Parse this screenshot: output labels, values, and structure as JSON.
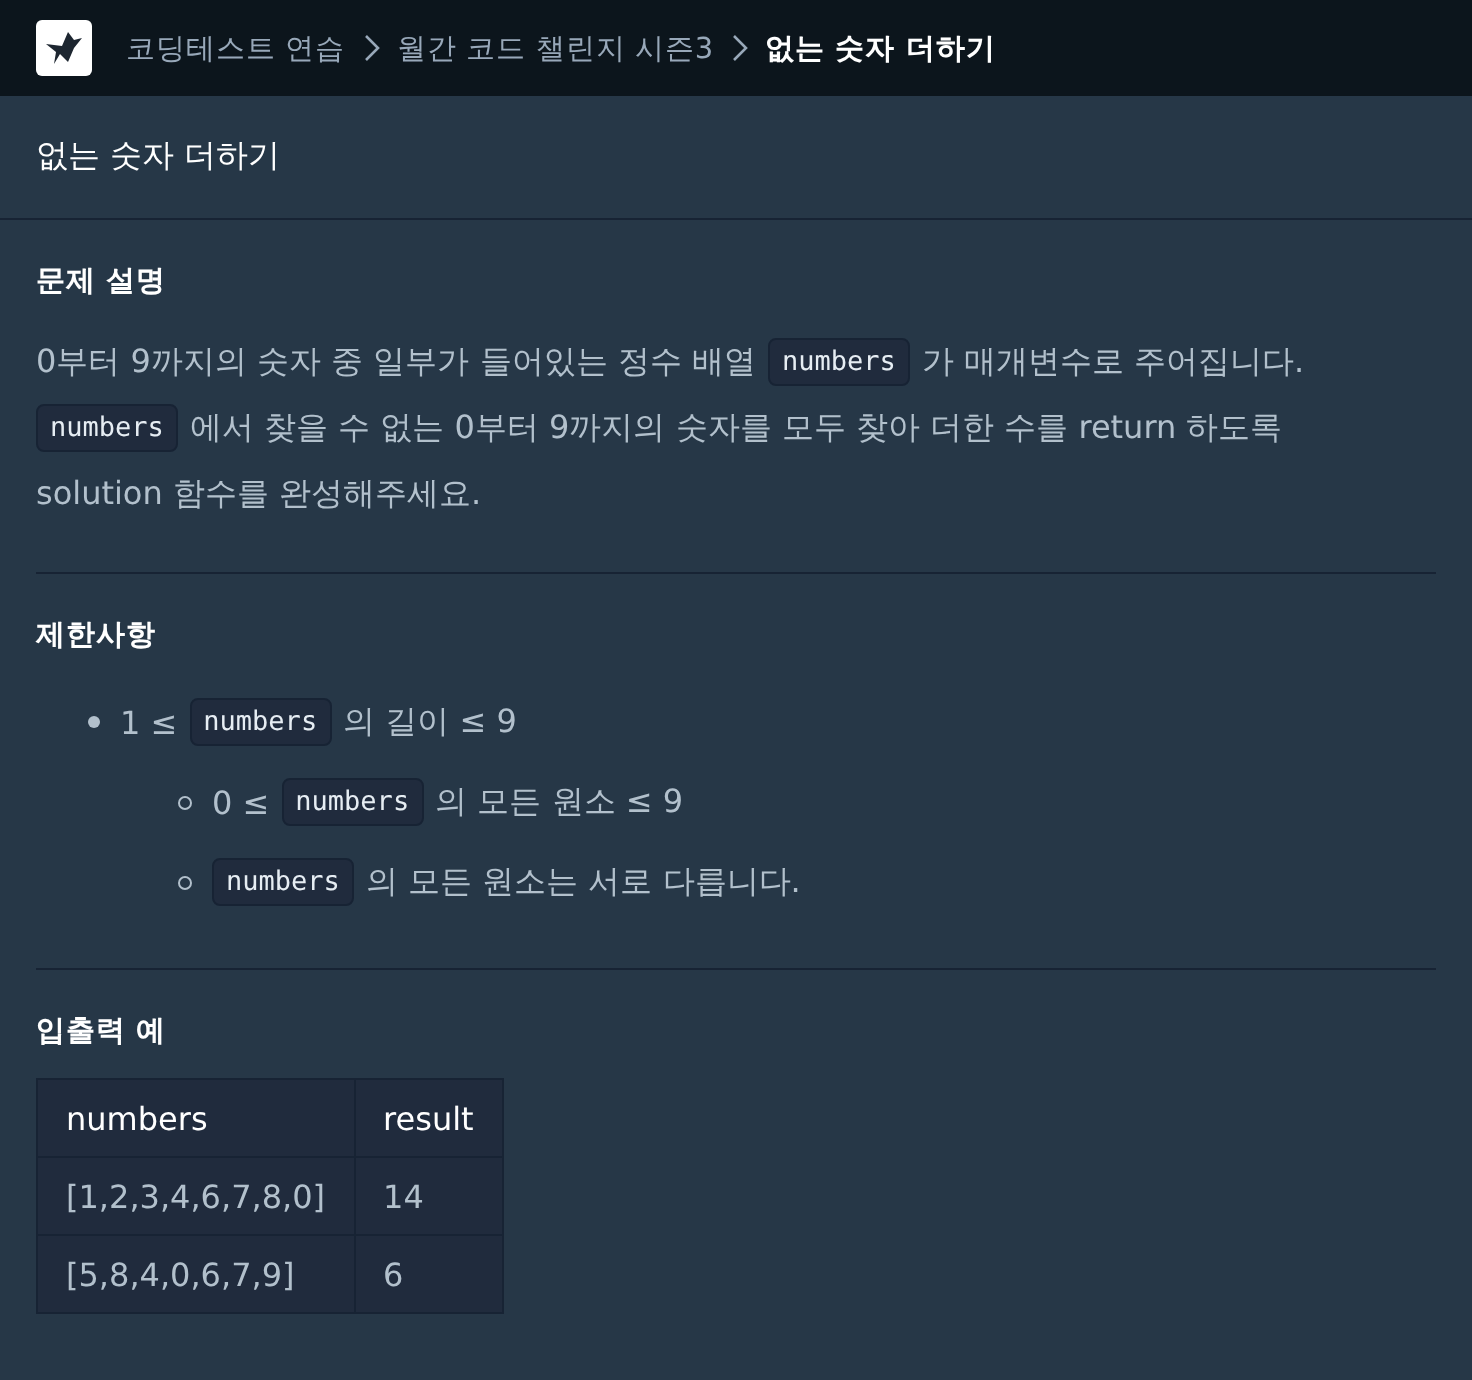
{
  "breadcrumb": [
    {
      "label": "코딩테스트 연습",
      "current": false
    },
    {
      "label": "월간 코드 챌린지 시즌3",
      "current": false
    },
    {
      "label": "없는 숫자 더하기",
      "current": true
    }
  ],
  "title": "없는 숫자 더하기",
  "sections": [
    {
      "kind": "paragraph",
      "heading": "문제 설명",
      "lines": [
        [
          {
            "kind": "text",
            "text": "0부터 9까지의 숫자 중 일부가 들어있는 정수 배열"
          },
          {
            "kind": "code",
            "text": "numbers"
          },
          {
            "kind": "text",
            "text": "가 매개변수로 주어집니다."
          }
        ],
        [
          {
            "kind": "code",
            "text": "numbers"
          },
          {
            "kind": "text",
            "text": "에서 찾을 수 없는 0부터 9까지의 숫자를 모두 찾아 더한 수를 return 하도록"
          }
        ],
        [
          {
            "kind": "text",
            "text": "solution 함수를 완성해주세요."
          }
        ]
      ]
    },
    {
      "kind": "list",
      "heading": "제한사항",
      "items": [
        {
          "parts": [
            {
              "kind": "text",
              "text": "1 ≤"
            },
            {
              "kind": "code",
              "text": "numbers"
            },
            {
              "kind": "text",
              "text": "의 길이 ≤ 9"
            }
          ],
          "children": [
            {
              "parts": [
                {
                  "kind": "text",
                  "text": "0 ≤"
                },
                {
                  "kind": "code",
                  "text": "numbers"
                },
                {
                  "kind": "text",
                  "text": "의 모든 원소 ≤ 9"
                }
              ]
            },
            {
              "parts": [
                {
                  "kind": "code",
                  "text": "numbers"
                },
                {
                  "kind": "text",
                  "text": "의 모든 원소는 서로 다릅니다."
                }
              ]
            }
          ]
        }
      ]
    },
    {
      "kind": "table",
      "heading": "입출력 예",
      "columns": [
        "numbers",
        "result"
      ],
      "rows": [
        [
          "[1,2,3,4,6,7,8,0]",
          "14"
        ],
        [
          "[5,8,4,0,6,7,9]",
          "6"
        ]
      ]
    }
  ]
}
